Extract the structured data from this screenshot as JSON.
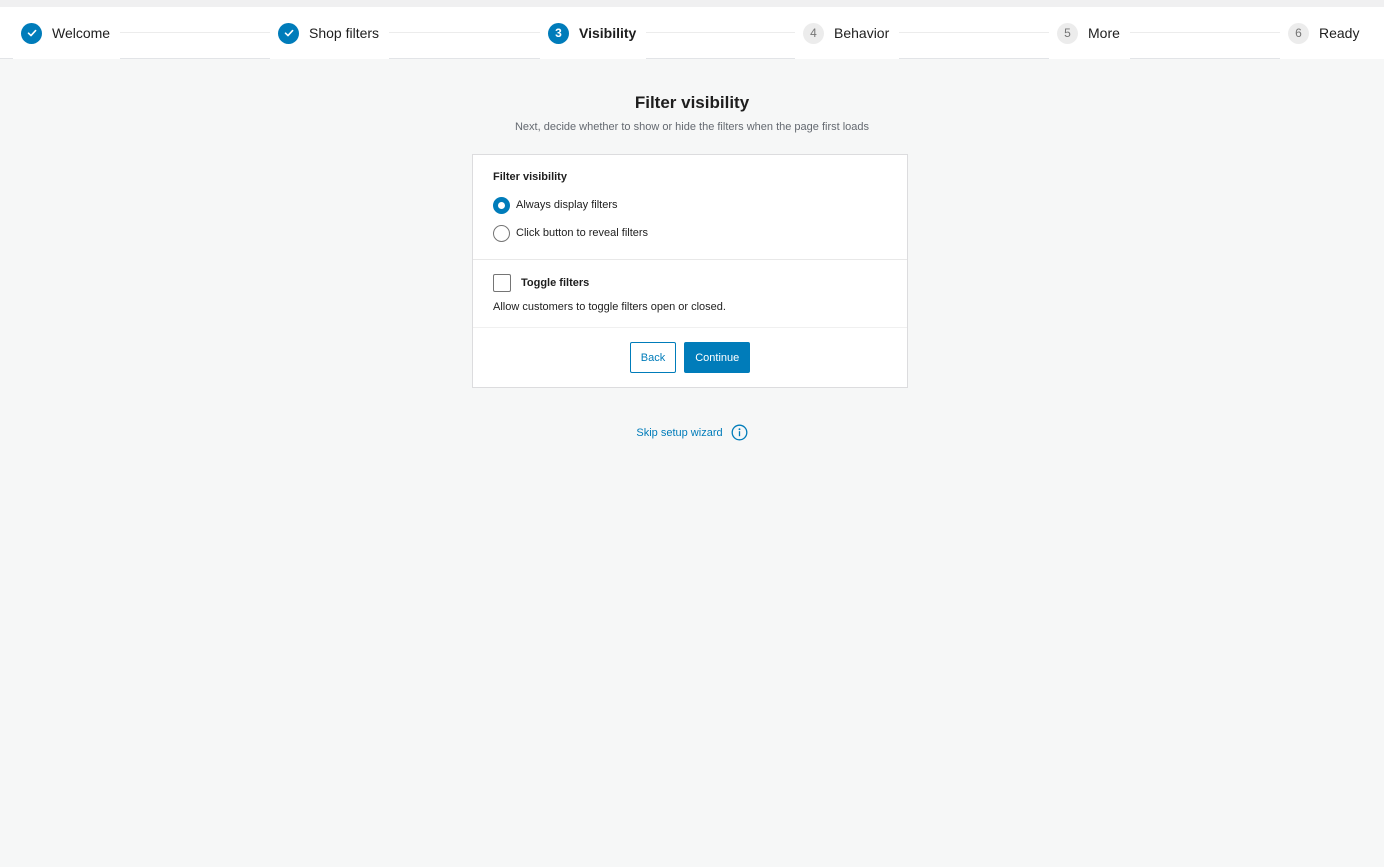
{
  "steps": [
    {
      "number": "1",
      "label": "Welcome",
      "state": "done"
    },
    {
      "number": "2",
      "label": "Shop filters",
      "state": "done"
    },
    {
      "number": "3",
      "label": "Visibility",
      "state": "current"
    },
    {
      "number": "4",
      "label": "Behavior",
      "state": "todo"
    },
    {
      "number": "5",
      "label": "More",
      "state": "todo"
    },
    {
      "number": "6",
      "label": "Ready",
      "state": "todo"
    }
  ],
  "page": {
    "title": "Filter visibility",
    "subtitle": "Next, decide whether to show or hide the filters when the page first loads"
  },
  "visibility": {
    "label": "Filter visibility",
    "options": [
      {
        "label": "Always display filters",
        "selected": true
      },
      {
        "label": "Click button to reveal filters",
        "selected": false
      }
    ]
  },
  "toggle": {
    "label": "Toggle filters",
    "checked": false,
    "help": "Allow customers to toggle filters open or closed."
  },
  "actions": {
    "back_label": "Back",
    "continue_label": "Continue"
  },
  "skip": {
    "label": "Skip setup wizard",
    "icon": "info-icon"
  },
  "colors": {
    "accent": "#007cba",
    "background": "#f6f7f7"
  }
}
